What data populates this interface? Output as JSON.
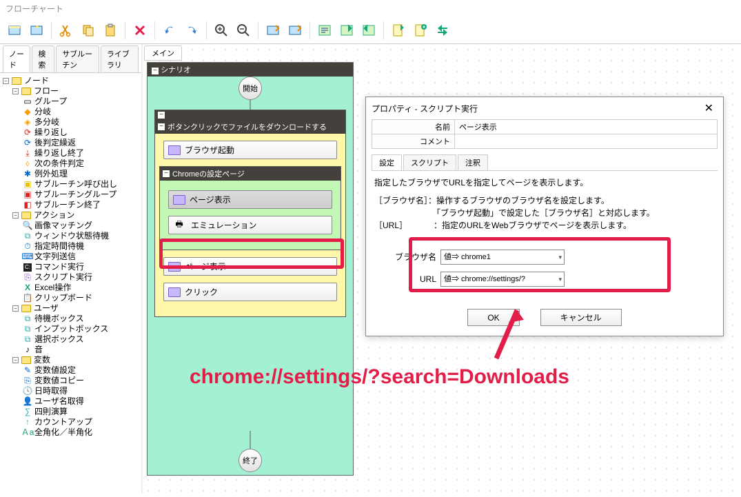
{
  "window_title": "フローチャート",
  "left_tabs": [
    "ノード",
    "検索",
    "サブルーチン",
    "ライブラリ"
  ],
  "left_active_tab": 0,
  "tree": {
    "root": "ノード",
    "groups": [
      {
        "label": "フロー",
        "items": [
          "グループ",
          "分岐",
          "多分岐",
          "繰り返し",
          "後判定繰返",
          "繰り返し終了",
          "次の条件判定",
          "例外処理",
          "サブルーチン呼び出し",
          "サブルーチングループ",
          "サブルーチン終了"
        ]
      },
      {
        "label": "アクション",
        "items": [
          "画像マッチング",
          "ウィンドウ状態待機",
          "指定時間待機",
          "文字列送信",
          "コマンド実行",
          "スクリプト実行",
          "Excel操作",
          "クリップボード"
        ]
      },
      {
        "label": "ユーザ",
        "items": [
          "待機ボックス",
          "インプットボックス",
          "選択ボックス",
          "音"
        ]
      },
      {
        "label": "変数",
        "items": [
          "変数値設定",
          "変数値コピー",
          "日時取得",
          "ユーザ名取得",
          "四則演算",
          "カウントアップ",
          "全角化／半角化"
        ]
      }
    ]
  },
  "center": {
    "main_tab": "メイン",
    "scenario_label": "シナリオ",
    "start": "開始",
    "end": "終了",
    "group1": {
      "title": "ボタンクリックでファイルをダウンロードする",
      "step_browser": "ブラウザ起動",
      "group2": {
        "title": "Chromeの設定ページ",
        "step_page": "ページ表示",
        "step_emul": "エミュレーション"
      },
      "step_page2": "ページ表示",
      "step_click": "クリック"
    }
  },
  "dialog": {
    "title": "プロパティ - スクリプト実行",
    "name_label": "名前",
    "name_value": "ページ表示",
    "comment_label": "コメント",
    "comment_value": "",
    "tabs": [
      "設定",
      "スクリプト",
      "注釈"
    ],
    "active_tab": 0,
    "desc_line": "指定したブラウザでURLを指定してページを表示します。",
    "help1_label": "［ブラウザ名］",
    "help1_text1": "：操作するブラウザのブラウザ名を設定します。",
    "help1_text2": "「ブラウザ起動」で設定した［ブラウザ名］と対応します。",
    "help2_label": "［URL］",
    "help2_text": "：指定のURLをWebブラウザでページを表示します。",
    "param_browser_label": "ブラウザ名",
    "param_browser_value": "値⇒ chrome1",
    "param_url_label": "URL",
    "param_url_value": "値⇒ chrome://settings/?",
    "ok": "OK",
    "cancel": "キャンセル"
  },
  "annotation": "chrome://settings/?search=Downloads"
}
